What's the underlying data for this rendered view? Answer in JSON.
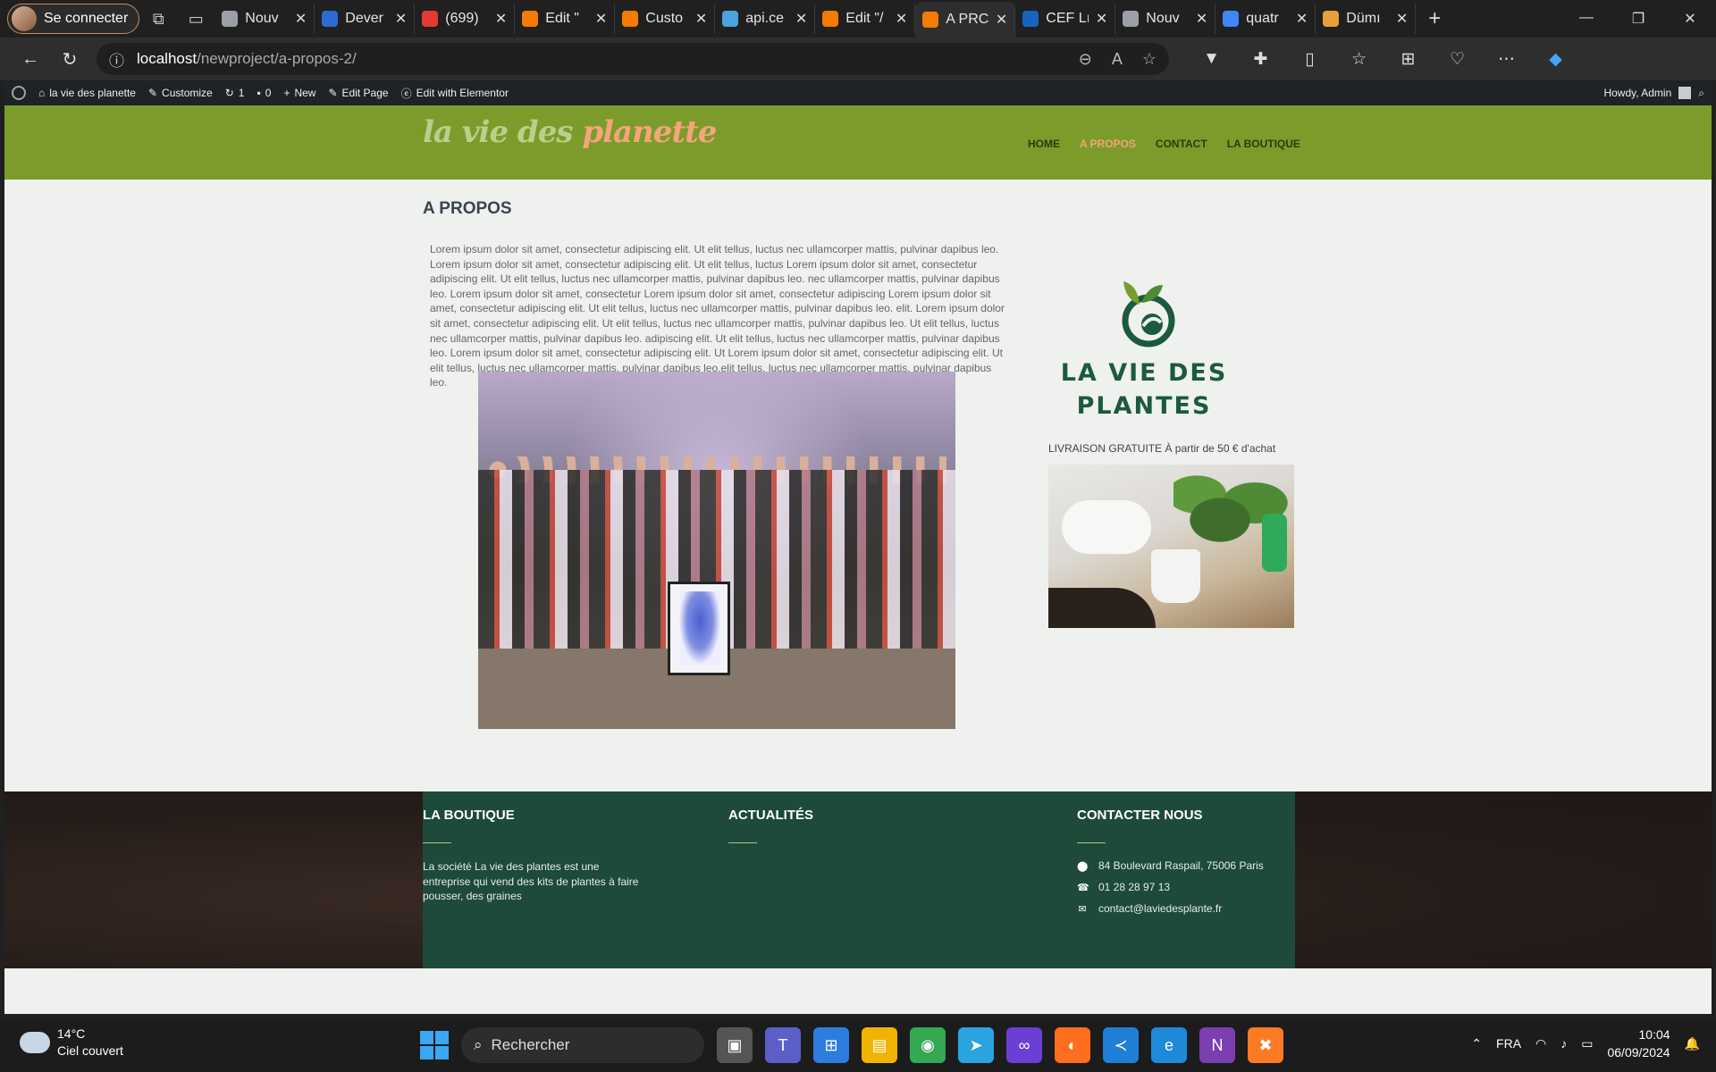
{
  "browser": {
    "profile_label": "Se connecter",
    "tabs": [
      {
        "title": "Nouv",
        "color": "#9aa0a6"
      },
      {
        "title": "Dever",
        "color": "#2b6cd4"
      },
      {
        "title": "(699)",
        "color": "#e53935"
      },
      {
        "title": "Edit \"",
        "color": "#f57c00"
      },
      {
        "title": "Custo",
        "color": "#f57c00"
      },
      {
        "title": "api.ce",
        "color": "#4aa3df"
      },
      {
        "title": "Edit \"/",
        "color": "#f57c00"
      },
      {
        "title": "A PRC",
        "color": "#f57c00"
      },
      {
        "title": "CEF Lı",
        "color": "#1565c0"
      },
      {
        "title": "Nouv",
        "color": "#9aa0a6"
      },
      {
        "title": "quatr",
        "color": "#4285f4"
      },
      {
        "title": "Dümı",
        "color": "#e8a03a"
      }
    ],
    "url_host": "localhost",
    "url_path": "/newproject/a-propos-2/"
  },
  "wpbar": {
    "site": "la vie des planette",
    "customize": "Customize",
    "updates": "1",
    "comments": "0",
    "new": "New",
    "edit_page": "Edit Page",
    "elementor": "Edit with Elementor",
    "howdy": "Howdy, Admin"
  },
  "site": {
    "logo_part1": "la vie des",
    "logo_part2": "planette",
    "menu": [
      "HOME",
      "A PROPOS",
      "CONTACT",
      "LA BOUTIQUE"
    ],
    "page_title": "A PROPOS",
    "intro": "Lorem ipsum dolor sit amet, consectetur adipiscing elit. Ut elit tellus, luctus nec ullamcorper mattis, pulvinar dapibus leo. Lorem ipsum dolor sit amet, consectetur adipiscing elit. Ut elit tellus, luctus Lorem ipsum dolor sit amet, consectetur adipiscing elit. Ut elit tellus, luctus nec ullamcorper mattis, pulvinar dapibus leo. nec ullamcorper mattis, pulvinar dapibus leo. Lorem ipsum dolor sit amet, consectetur Lorem ipsum dolor sit amet, consectetur adipiscing Lorem ipsum dolor sit amet, consectetur adipiscing elit. Ut elit tellus, luctus nec ullamcorper mattis, pulvinar dapibus leo. elit. Lorem ipsum dolor sit amet, consectetur adipiscing elit. Ut elit tellus, luctus nec ullamcorper mattis, pulvinar dapibus leo. Ut elit tellus, luctus nec ullamcorper mattis, pulvinar dapibus leo. adipiscing elit. Ut elit tellus, luctus nec ullamcorper mattis, pulvinar dapibus leo. Lorem ipsum dolor sit amet, consectetur adipiscing elit. Ut Lorem ipsum dolor sit amet, consectetur adipiscing elit. Ut elit tellus, luctus nec ullamcorper mattis, pulvinar dapibus leo.elit tellus, luctus nec ullamcorper mattis, pulvinar dapibus leo.",
    "brand_line1": "LA VIE DES",
    "brand_line2": "PLANTES",
    "delivery": "LIVRAISON GRATUITE À partir de 50 € d'achat"
  },
  "footer": {
    "col1_title": "LA BOUTIQUE",
    "col1_text": "La société La vie des plantes est une entreprise qui vend des kits de plantes à faire pousser, des graines",
    "col2_title": "ACTUALITÉS",
    "col3_title": "CONTACTER NOUS",
    "address": "84 Boulevard Raspail, 75006 Paris",
    "phone": "01 28 28 97 13",
    "email": "contact@laviedesplante.fr"
  },
  "taskbar": {
    "temp": "14°C",
    "weather": "Ciel couvert",
    "search_placeholder": "Rechercher",
    "lang": "FRA",
    "time": "10:04",
    "date": "06/09/2024"
  },
  "colors": {
    "header_green": "#7b9c2b",
    "accent_salmon": "#f4a57c",
    "footer_green": "#1d4a3a",
    "brand_dark_green": "#1b5a3c"
  }
}
